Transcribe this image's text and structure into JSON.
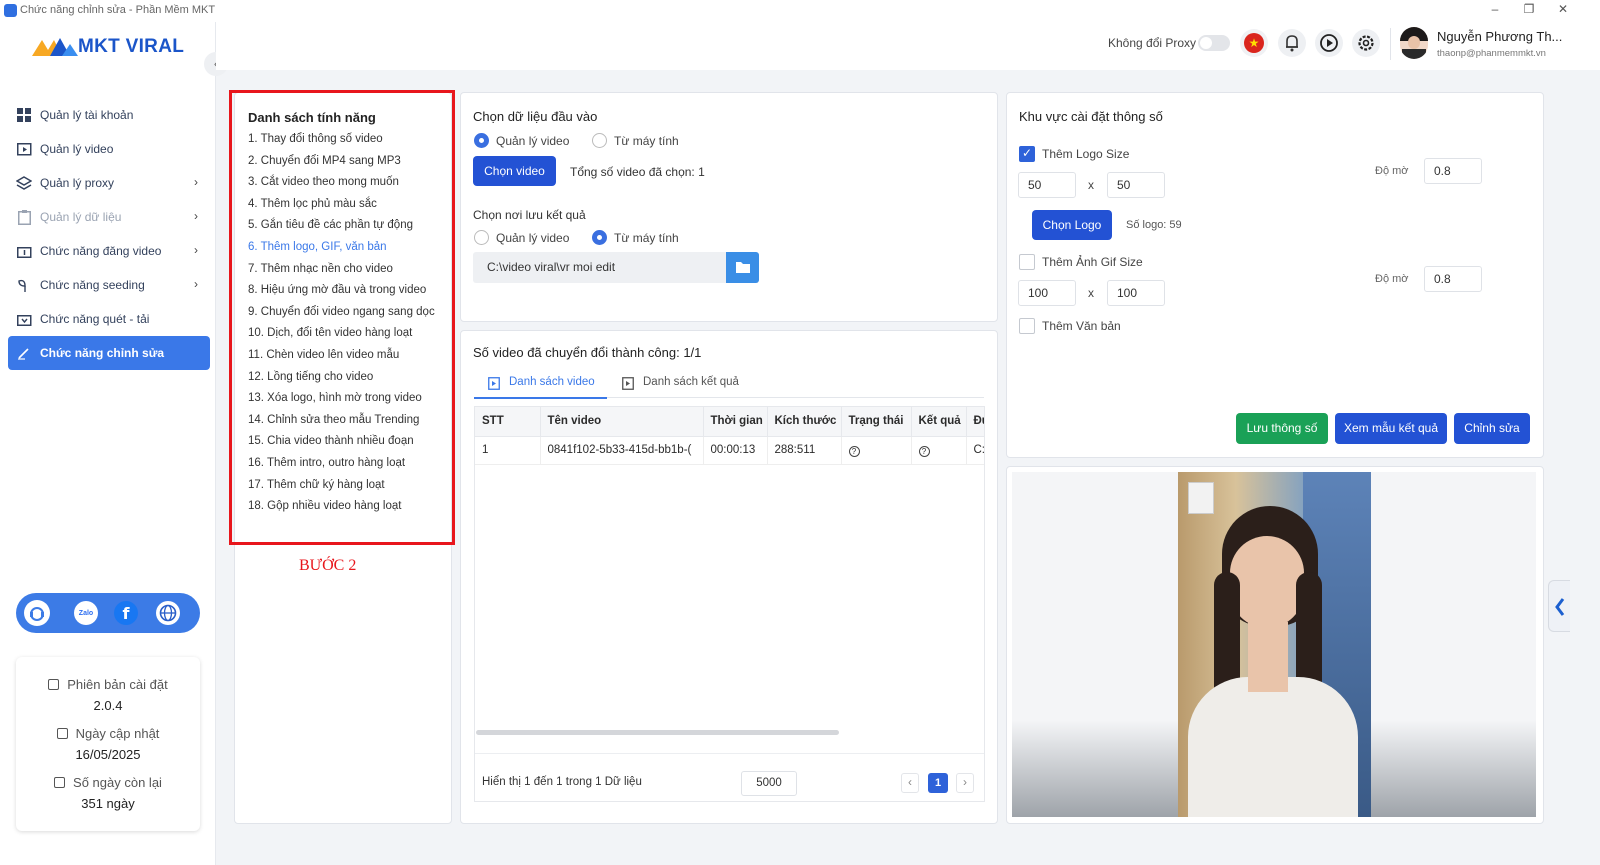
{
  "window": {
    "title": "Chức năng chỉnh sửa - Phần Mềm MKT"
  },
  "brand": {
    "logo_text": "MKT VIRAL"
  },
  "sidebar": {
    "items": [
      {
        "label": "Quản lý tài khoản",
        "icon": "grid-icon",
        "has_chevron": false
      },
      {
        "label": "Quản lý video",
        "icon": "video-icon",
        "has_chevron": false
      },
      {
        "label": "Quản lý proxy",
        "icon": "layers-icon",
        "has_chevron": true
      },
      {
        "label": "Quản lý dữ liệu",
        "icon": "clipboard-icon",
        "has_chevron": true
      },
      {
        "label": "Chức năng đăng video",
        "icon": "upload-icon",
        "has_chevron": true
      },
      {
        "label": "Chức năng seeding",
        "icon": "seedling-icon",
        "has_chevron": true
      },
      {
        "label": "Chức năng quét - tải",
        "icon": "download-icon",
        "has_chevron": false
      },
      {
        "label": "Chức năng chỉnh sửa",
        "icon": "pencil-icon",
        "has_chevron": false
      }
    ],
    "active_index": 7,
    "info": {
      "version_label": "Phiên bản cài đặt",
      "version_value": "2.0.4",
      "update_label": "Ngày cập nhật",
      "update_value": "16/05/2025",
      "days_label": "Số ngày còn lại",
      "days_value": "351 ngày"
    },
    "social": {
      "zalo_text": "Zalo"
    }
  },
  "header": {
    "proxy_label": "Không đổi Proxy",
    "user_name": "Nguyễn Phương Th...",
    "user_email": "thaonp@phanmemmkt.vn"
  },
  "features": {
    "title": "Danh sách tính năng",
    "items": [
      "1. Thay đổi thông số video",
      "2. Chuyển đổi MP4 sang MP3",
      "3. Cắt video theo mong muốn",
      "4. Thêm lọc phủ màu sắc",
      "5. Gắn tiêu đề các phần tự động",
      "6. Thêm logo, GIF, văn bản",
      "7. Thêm nhạc nền cho video",
      "8. Hiệu ứng mờ đầu và trong video",
      "9. Chuyển đổi video ngang sang dọc",
      "10. Dịch, đổi tên video hàng loạt",
      "11. Chèn video lên video mẫu",
      "12. Lồng tiếng cho video",
      "13. Xóa logo, hình mờ trong video",
      "14. Chỉnh sửa theo mẫu Trending",
      "15. Chia video thành nhiều đoạn",
      "16. Thêm intro, outro hàng loạt",
      "17. Thêm chữ ký hàng loạt",
      "18. Gộp nhiều video hàng loạt"
    ],
    "selected_index": 5,
    "step_label": "BƯỚC 2",
    "highlight_color": "#e8161c"
  },
  "input": {
    "title": "Chọn dữ liệu đầu vào",
    "option_manage": "Quản lý video",
    "option_computer": "Từ máy tính",
    "choose_button": "Chọn video",
    "total_selected": "Tổng số video đã chọn: 1",
    "save_title": "Chọn nơi lưu kết quả",
    "save_option_manage": "Quản lý video",
    "save_option_computer": "Từ máy tính",
    "save_path": "C:\\video viral\\vr moi edit"
  },
  "results": {
    "title": "Số video đã chuyển đổi thành công: 1/1",
    "tabs": [
      "Danh sách video",
      "Danh sách kết quả"
    ],
    "columns": [
      "STT",
      "Tên video",
      "Thời gian",
      "Kích thước",
      "Trạng thái",
      "Kết quả",
      "Đư"
    ],
    "rows": [
      {
        "stt": "1",
        "name": "0841f102-5b33-415d-bb1b-(",
        "time": "00:00:13",
        "size": "288:511",
        "status": "?",
        "result": "?",
        "path": "C:"
      }
    ],
    "footer_text": "Hiển thị 1 đến 1 trong 1 Dữ liệu",
    "page_size": "5000",
    "current_page": "1",
    "prev": "‹",
    "next": "›"
  },
  "settings": {
    "title": "Khu vực cài đặt thông số",
    "logo_size_label": "Thêm Logo Size",
    "logo_checked": true,
    "logo_w": "50",
    "logo_h": "50",
    "logo_opacity_label": "Độ mờ",
    "logo_opacity": "0.8",
    "choose_logo": "Chọn Logo",
    "logo_count": "Số logo: 59",
    "gif_size_label": "Thêm Ảnh Gif Size",
    "gif_checked": false,
    "gif_w": "100",
    "gif_h": "100",
    "gif_opacity_label": "Độ mờ",
    "gif_opacity": "0.8",
    "text_label": "Thêm Văn bản",
    "text_checked": false,
    "times": "x",
    "save_btn": "Lưu thông số",
    "preview_btn": "Xem mẫu kết quả",
    "edit_btn": "Chỉnh sửa"
  },
  "colors": {
    "primary": "#2352d4",
    "accent": "#3a78e8",
    "success": "#1aa157",
    "danger": "#e8161c"
  }
}
